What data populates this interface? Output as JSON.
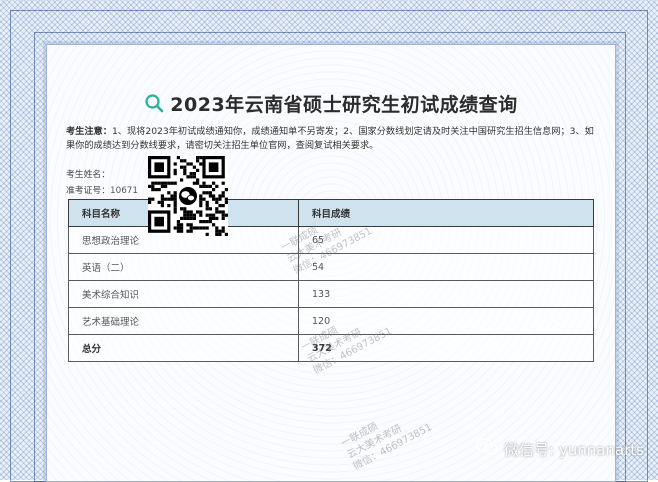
{
  "page": {
    "title": "2023年云南省硕士研究生初试成绩查询"
  },
  "notice": {
    "label": "考生注意：",
    "text": "1、现将2023年初试成绩通知你，成绩通知单不另寄发；2、国家分数线划定请及时关注中国研究生招生信息网；3、如果你的成绩达到分数线要求，请密切关注招生单位官网，查阅复试相关要求。"
  },
  "candidate": {
    "name_label": "考生姓名：",
    "id_label": "准考证号：",
    "id_value": "10671"
  },
  "table": {
    "headers": [
      "科目名称",
      "科目成绩"
    ],
    "rows": [
      {
        "subject": "思想政治理论",
        "score": "65"
      },
      {
        "subject": "英语（二）",
        "score": "54"
      },
      {
        "subject": "美术综合知识",
        "score": "133"
      },
      {
        "subject": "艺术基础理论",
        "score": "120"
      }
    ],
    "total": {
      "subject": "总分",
      "score": "372"
    }
  },
  "watermarks": [
    {
      "line1": "一联成硕",
      "line2": "云大美术考研",
      "line3": "微信：466973851"
    },
    {
      "line1": "一联成硕",
      "line2": "云大美术考研",
      "line3": "微信：466973851"
    },
    {
      "line1": "一联成硕",
      "line2": "云大美术考研",
      "line3": "微信：466973851"
    }
  ],
  "wechat": {
    "label": "微信号: yunnanarts"
  },
  "colors": {
    "header_bg": "#cfe3ee",
    "border_blue": "#9fb3d6",
    "icon_teal": "#25b39a"
  },
  "icons": {
    "title_icon": "search-icon",
    "qr_center_icon": "wechat-icon",
    "footer_icon": "wechat-icon"
  }
}
